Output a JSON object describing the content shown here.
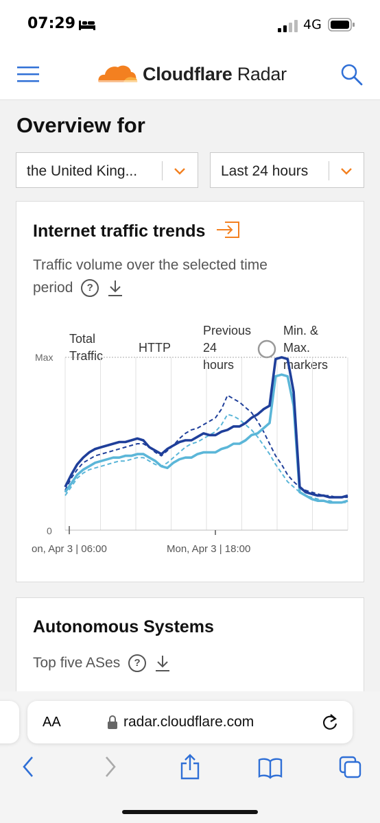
{
  "status_bar": {
    "time": "07:29",
    "network": "4G"
  },
  "header": {
    "brand_name_bold": "Cloudflare",
    "brand_name_light": " Radar"
  },
  "page": {
    "title": "Overview for"
  },
  "filters": {
    "location": "the United King...",
    "time_range": "Last 24 hours"
  },
  "traffic_card": {
    "title": "Internet traffic trends",
    "subtitle_line1": "Traffic volume over the selected time",
    "subtitle_line2": "period",
    "legend": {
      "total_line1": "Total",
      "total_line2": "Traffic",
      "http": "HTTP",
      "previous_line1": "Previous",
      "previous_line2": "24",
      "previous_line3": "hours",
      "minmax_line1": "Min. &",
      "minmax_line2": "Max.",
      "minmax_line3": "markers"
    }
  },
  "chart_data": {
    "type": "line",
    "y_tick_labels": [
      "Max",
      "0"
    ],
    "x_tick_labels": [
      "on, Apr 3 | 06:00",
      "Mon, Apr 3 | 18:00"
    ],
    "ylim": [
      0,
      100
    ],
    "x": [
      0,
      1,
      2,
      3,
      4,
      5,
      6,
      7,
      8,
      9,
      10,
      11,
      12,
      13,
      14,
      15,
      16,
      17,
      18,
      19,
      20,
      21,
      22,
      23,
      24,
      25,
      26,
      27,
      28,
      29,
      30,
      31,
      32,
      33,
      34,
      35,
      36,
      37,
      38,
      39,
      40,
      41,
      42,
      43,
      44,
      45,
      46,
      47
    ],
    "series": [
      {
        "name": "Total Traffic",
        "color": "#1f3f9a",
        "dashed": false,
        "values": [
          25,
          32,
          38,
          42,
          45,
          47,
          48,
          49,
          50,
          51,
          51,
          52,
          53,
          52,
          48,
          46,
          44,
          47,
          49,
          51,
          52,
          52,
          54,
          56,
          55,
          55,
          57,
          58,
          60,
          60,
          62,
          65,
          67,
          70,
          72,
          99,
          100,
          99,
          80,
          25,
          22,
          21,
          20,
          20,
          19,
          19,
          19,
          20
        ]
      },
      {
        "name": "HTTP",
        "color": "#5bb6d8",
        "dashed": false,
        "values": [
          22,
          27,
          32,
          35,
          37,
          39,
          40,
          41,
          42,
          42,
          43,
          43,
          44,
          44,
          42,
          40,
          37,
          36,
          39,
          41,
          42,
          42,
          44,
          45,
          45,
          45,
          47,
          48,
          50,
          50,
          52,
          55,
          56,
          59,
          62,
          89,
          90,
          89,
          72,
          22,
          20,
          18,
          17,
          17,
          16,
          16,
          16,
          17
        ]
      },
      {
        "name": "Previous 24 hours (Total Traffic)",
        "color": "#1f3f9a",
        "dashed": true,
        "values": [
          23,
          30,
          35,
          39,
          41,
          43,
          44,
          45,
          46,
          47,
          48,
          49,
          50,
          50,
          48,
          45,
          43,
          46,
          49,
          53,
          56,
          58,
          59,
          61,
          63,
          65,
          70,
          78,
          76,
          74,
          71,
          68,
          63,
          57,
          50,
          43,
          38,
          32,
          28,
          25,
          23,
          22,
          21,
          20,
          20,
          19,
          19,
          19
        ]
      },
      {
        "name": "Previous 24 hours (HTTP)",
        "color": "#5bb6d8",
        "dashed": true,
        "values": [
          20,
          25,
          30,
          33,
          35,
          36,
          37,
          38,
          39,
          40,
          40,
          41,
          42,
          42,
          40,
          38,
          37,
          39,
          42,
          45,
          48,
          50,
          51,
          53,
          55,
          57,
          61,
          67,
          66,
          64,
          61,
          58,
          54,
          49,
          44,
          38,
          33,
          28,
          25,
          22,
          20,
          19,
          18,
          17,
          17,
          16,
          16,
          16
        ]
      }
    ]
  },
  "as_card": {
    "title": "Autonomous Systems",
    "subtitle": "Top five ASes"
  },
  "browser": {
    "aa_label": "AA",
    "url": "radar.cloudflare.com"
  },
  "colors": {
    "accent_orange": "#f38020",
    "link_blue": "#2f6fd6",
    "dark_blue": "#1f3f9a",
    "light_blue": "#5bb6d8"
  }
}
